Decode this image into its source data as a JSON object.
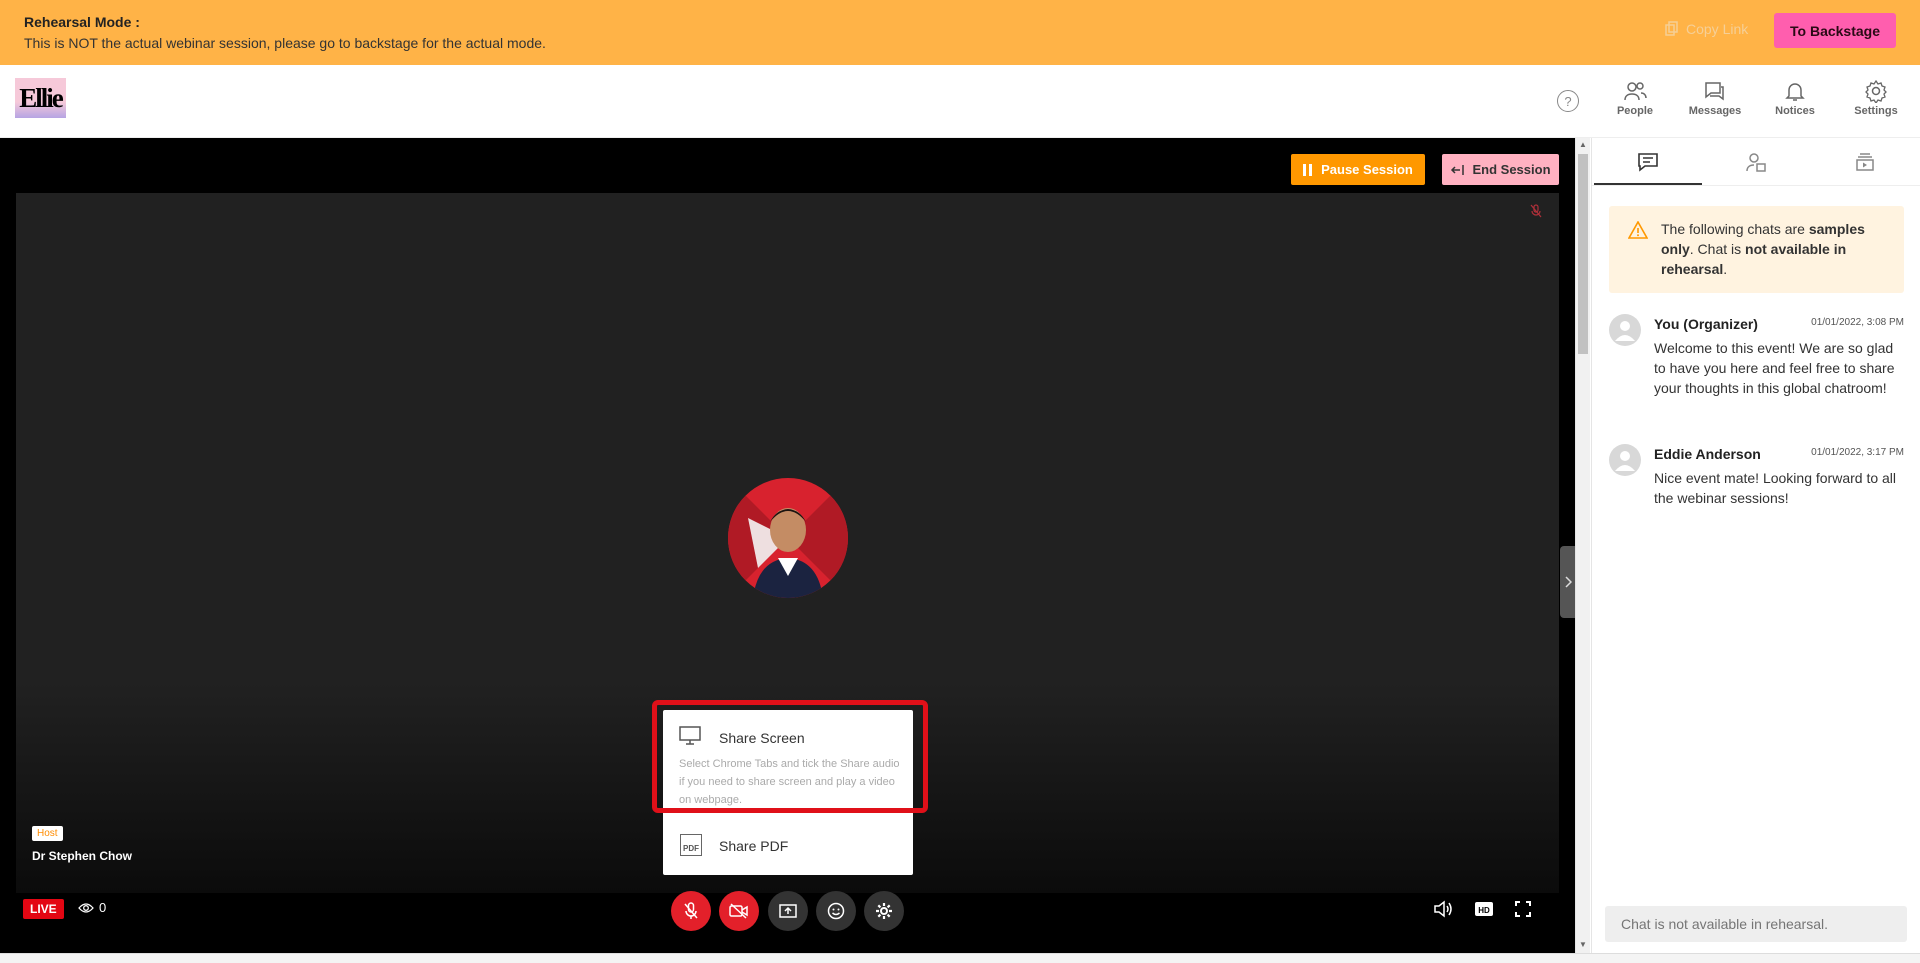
{
  "banner": {
    "title": "Rehearsal Mode :",
    "text": "This is NOT the actual webinar session, please go to backstage for the actual mode.",
    "copy_link": "Copy Link",
    "to_backstage": "To Backstage"
  },
  "header": {
    "logo_text": "Ellie",
    "nav": [
      {
        "label": "People",
        "icon": "people-icon"
      },
      {
        "label": "Messages",
        "icon": "messages-icon"
      },
      {
        "label": "Notices",
        "icon": "bell-icon"
      },
      {
        "label": "Settings",
        "icon": "gear-icon"
      }
    ]
  },
  "stage": {
    "pause_label": "Pause Session",
    "end_label": "End Session",
    "host_badge": "Host",
    "host_name": "Dr Stephen Chow",
    "live_label": "LIVE",
    "viewer_count": "0"
  },
  "share_menu": {
    "screen_title": "Share Screen",
    "screen_desc": "Select Chrome Tabs and tick the Share audio if you need to share screen and play a video on webpage.",
    "pdf_title": "Share PDF",
    "pdf_icon_text": "PDF"
  },
  "chat": {
    "notice_prefix": "The following chats are ",
    "notice_bold1": "samples only",
    "notice_mid": ". Chat is ",
    "notice_bold2": "not available in rehearsal",
    "notice_suffix": ".",
    "messages": [
      {
        "name": "You (Organizer)",
        "time": "01/01/2022, 3:08 PM",
        "text": "Welcome to this event! We are so glad to have you here and feel free to share your thoughts in this global chatroom!"
      },
      {
        "name": "Eddie Anderson",
        "time": "01/01/2022, 3:17 PM",
        "text": "Nice event mate! Looking forward to all the webinar sessions!"
      }
    ],
    "input_placeholder": "Chat is not available in rehearsal."
  },
  "colors": {
    "banner": "#ffb347",
    "accent_pink": "#ff5eae",
    "live_red": "#e30613",
    "pause_orange": "#ff9800",
    "highlight_red": "#e01019"
  }
}
